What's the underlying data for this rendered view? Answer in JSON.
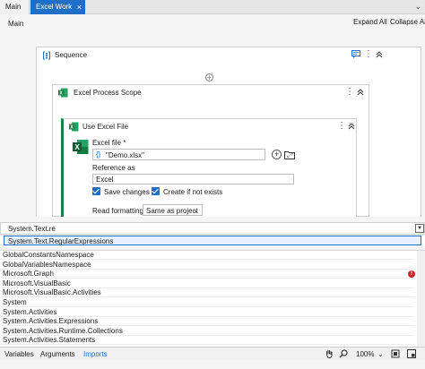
{
  "tabs": [
    {
      "label": "Main"
    },
    {
      "label": "Excel Work"
    }
  ],
  "icons": {
    "tab_close": "×",
    "tabstrip_menu": "⌄"
  },
  "header": {
    "breadcrumb": "Main",
    "expand_all": "Expand All",
    "collapse_all": "Collapse All"
  },
  "sequence": {
    "title": "Sequence"
  },
  "excel_process_scope": {
    "title": "Excel Process Scope"
  },
  "use_excel_file": {
    "title": "Use Excel File",
    "excel_file_label": "Excel file",
    "required_marker": "*",
    "excel_file_value": "\"Demo.xlsx\"",
    "reference_as_label": "Reference as",
    "reference_as_value": "Excel",
    "save_changes_label": "Save changes",
    "save_changes_checked": true,
    "create_if_not_exists_label": "Create if not exists",
    "create_if_not_exists_checked": true,
    "read_formatting_label": "Read formatting",
    "read_formatting_value": "Same as project"
  },
  "imports_panel": {
    "search_value": "System.Text.re",
    "suggestion": "System.Text.RegularExpressions",
    "items": [
      {
        "name": "GlobalConstantsNamespace",
        "warning": false
      },
      {
        "name": "GlobalVariablesNamespace",
        "warning": false
      },
      {
        "name": "Microsoft.Graph",
        "warning": true
      },
      {
        "name": "Microsoft.VisualBasic",
        "warning": false
      },
      {
        "name": "Microsoft.VisualBasic.Activities",
        "warning": false
      },
      {
        "name": "System",
        "warning": false
      },
      {
        "name": "System.Activities",
        "warning": false
      },
      {
        "name": "System.Activities.Expressions",
        "warning": false
      },
      {
        "name": "System.Activities.Runtime.Collections",
        "warning": false
      },
      {
        "name": "System.Activities.Statements",
        "warning": false
      }
    ]
  },
  "bottom_bar": {
    "variables": "Variables",
    "arguments": "Arguments",
    "imports": "Imports",
    "zoom": "100%"
  },
  "colors": {
    "accent": "#1f6fc7",
    "excel_green": "#1e7e45",
    "warning_red": "#c62828"
  }
}
